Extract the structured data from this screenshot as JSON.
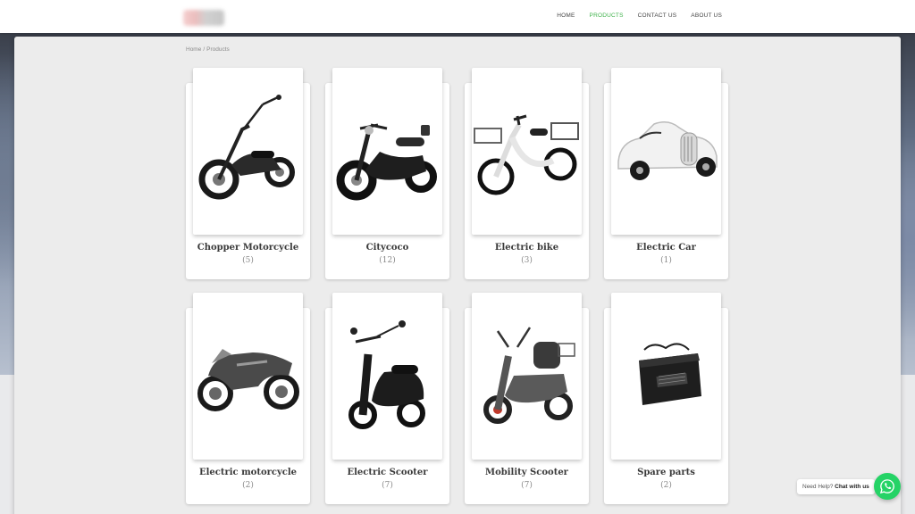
{
  "header": {
    "logo_alt": "logo",
    "nav": [
      {
        "label": "HOME",
        "active": false
      },
      {
        "label": "PRODUCTS",
        "active": true
      },
      {
        "label": "CONTACT US",
        "active": false
      },
      {
        "label": "ABOUT US",
        "active": false
      }
    ]
  },
  "breadcrumb": {
    "home": "Home",
    "separator": "/",
    "current": "Products"
  },
  "products": [
    {
      "name": "Chopper Motorcycle",
      "count": "5",
      "icon": "chopper-motorcycle-icon"
    },
    {
      "name": "Citycoco",
      "count": "12",
      "icon": "citycoco-scooter-icon"
    },
    {
      "name": "Electric bike",
      "count": "3",
      "icon": "electric-bike-icon"
    },
    {
      "name": "Electric Car",
      "count": "1",
      "icon": "electric-car-icon"
    },
    {
      "name": "Electric motorcycle",
      "count": "2",
      "icon": "electric-motorcycle-icon"
    },
    {
      "name": "Electric Scooter",
      "count": "7",
      "icon": "electric-scooter-icon"
    },
    {
      "name": "Mobility Scooter",
      "count": "7",
      "icon": "mobility-scooter-icon"
    },
    {
      "name": "Spare parts",
      "count": "2",
      "icon": "charger-icon"
    }
  ],
  "whatsapp": {
    "prefix": "Need Help?",
    "cta": "Chat with us",
    "accent": "#25d366"
  },
  "colors": {
    "nav_active": "#3fb24b",
    "panel": "#ececec"
  }
}
